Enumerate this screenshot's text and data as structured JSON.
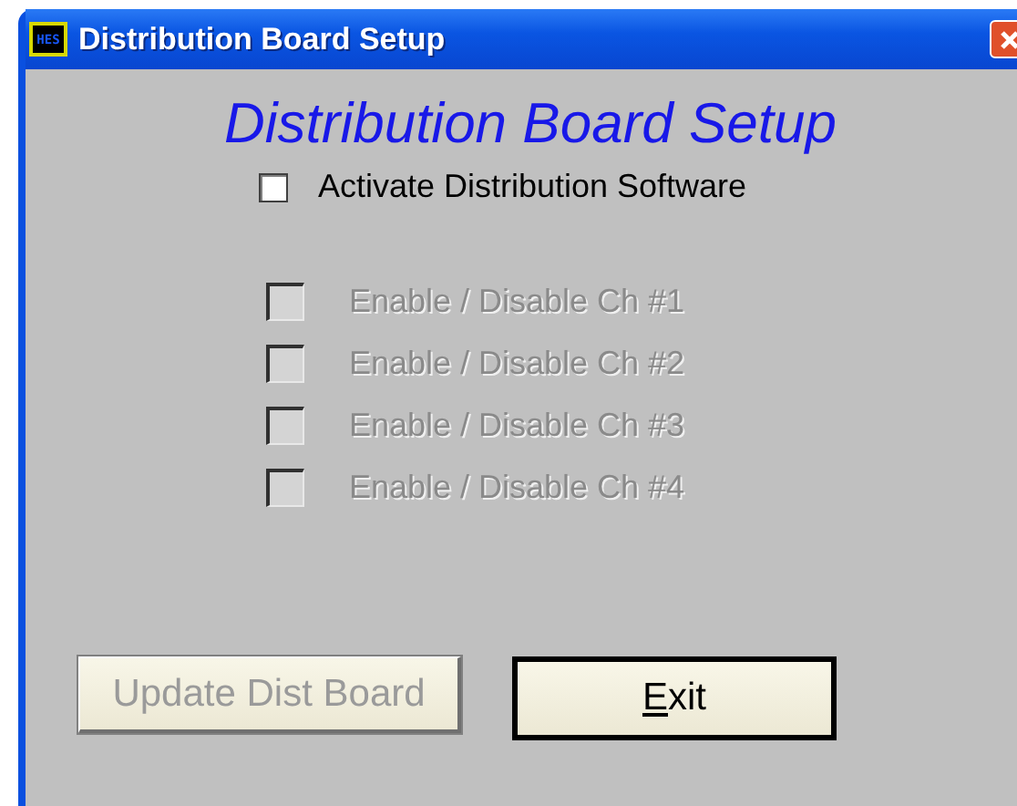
{
  "window": {
    "title": "Distribution Board Setup",
    "icon_text": "HES"
  },
  "heading": "Distribution Board Setup",
  "activate": {
    "label": "Activate Distribution Software",
    "checked": false,
    "disabled": false
  },
  "channels": [
    {
      "label": "Enable / Disable Ch #1",
      "checked": false,
      "disabled": true
    },
    {
      "label": "Enable / Disable Ch #2",
      "checked": false,
      "disabled": true
    },
    {
      "label": "Enable / Disable Ch #3",
      "checked": false,
      "disabled": true
    },
    {
      "label": "Enable / Disable Ch #4",
      "checked": false,
      "disabled": true
    }
  ],
  "buttons": [
    {
      "label": "Update Dist Board",
      "disabled": true,
      "default": false
    },
    {
      "access_key": "E",
      "label_rest": "xit",
      "disabled": false,
      "default": true
    }
  ]
}
